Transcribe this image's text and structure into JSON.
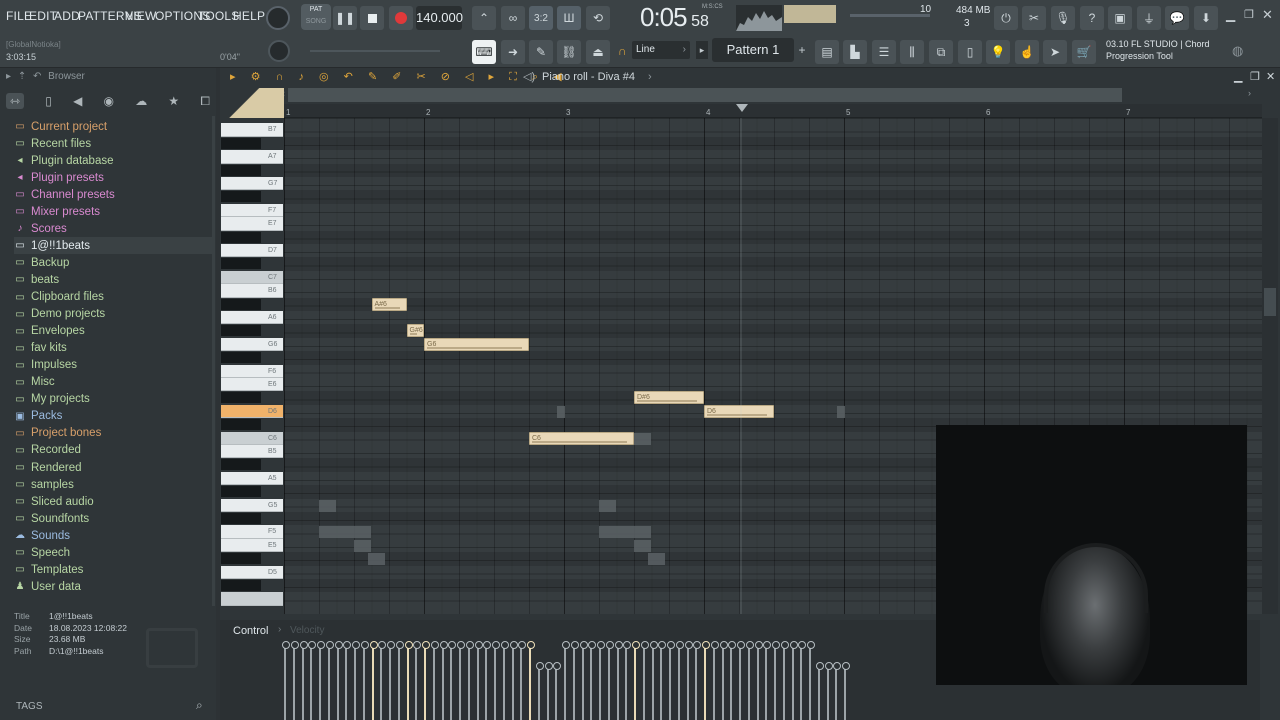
{
  "menu": [
    "FILE",
    "EDIT",
    "ADD",
    "PATTERNS",
    "VIEW",
    "OPTIONS",
    "TOOLS",
    "HELP"
  ],
  "transport": {
    "pat_label": "PAT",
    "song_label": "SONG",
    "tempo": "140.000",
    "time": "0:05",
    "time_small": "58",
    "time_unit": "M:S:CS",
    "cpu": "10",
    "mem": "484 MB",
    "voices": "3"
  },
  "hint": {
    "global": "[GlobalNotioka]",
    "time": "3:03:15",
    "position": "0'04\""
  },
  "snap": "Line",
  "pattern": "Pattern 1",
  "news": {
    "line1": "03.10  FL STUDIO | Chord",
    "line2": "Progression Tool"
  },
  "browser": {
    "title": "Browser",
    "items": [
      {
        "label": "Current project",
        "icon": "folder",
        "color": "#d8a06a"
      },
      {
        "label": "Recent files",
        "icon": "folder",
        "color": "#b7d6a4"
      },
      {
        "label": "Plugin database",
        "icon": "plug",
        "color": "#b7d6a4"
      },
      {
        "label": "Plugin presets",
        "icon": "plug",
        "color": "#d98ad0"
      },
      {
        "label": "Channel presets",
        "icon": "folder",
        "color": "#d98ad0"
      },
      {
        "label": "Mixer presets",
        "icon": "folder",
        "color": "#d98ad0"
      },
      {
        "label": "Scores",
        "icon": "note",
        "color": "#d98ad0"
      },
      {
        "label": "1@!!1beats",
        "icon": "folder",
        "color": "#e3ebef"
      },
      {
        "label": "Backup",
        "icon": "folder",
        "color": "#b7d6a4"
      },
      {
        "label": "beats",
        "icon": "folder",
        "color": "#b7d6a4"
      },
      {
        "label": "Clipboard files",
        "icon": "folder",
        "color": "#b7d6a4"
      },
      {
        "label": "Demo projects",
        "icon": "folder",
        "color": "#b7d6a4"
      },
      {
        "label": "Envelopes",
        "icon": "folder",
        "color": "#b7d6a4"
      },
      {
        "label": "fav kits",
        "icon": "folder",
        "color": "#b7d6a4"
      },
      {
        "label": "Impulses",
        "icon": "folder",
        "color": "#b7d6a4"
      },
      {
        "label": "Misc",
        "icon": "folder",
        "color": "#b7d6a4"
      },
      {
        "label": "My projects",
        "icon": "folder",
        "color": "#b7d6a4"
      },
      {
        "label": "Packs",
        "icon": "pack",
        "color": "#9bbbe0"
      },
      {
        "label": "Project bones",
        "icon": "folder",
        "color": "#d8a06a"
      },
      {
        "label": "Recorded",
        "icon": "folder",
        "color": "#b7d6a4"
      },
      {
        "label": "Rendered",
        "icon": "folder",
        "color": "#b7d6a4"
      },
      {
        "label": "samples",
        "icon": "folder",
        "color": "#b7d6a4"
      },
      {
        "label": "Sliced audio",
        "icon": "folder",
        "color": "#b7d6a4"
      },
      {
        "label": "Soundfonts",
        "icon": "folder",
        "color": "#b7d6a4"
      },
      {
        "label": "Sounds",
        "icon": "cloud",
        "color": "#9bbbe0"
      },
      {
        "label": "Speech",
        "icon": "folder",
        "color": "#b7d6a4"
      },
      {
        "label": "Templates",
        "icon": "folder",
        "color": "#b7d6a4"
      },
      {
        "label": "User data",
        "icon": "user",
        "color": "#b7d6a4"
      }
    ],
    "info": {
      "title_label": "Title",
      "title": "1@!!1beats",
      "date_label": "Date",
      "date": "18.08.2023 12:08:22",
      "size_label": "Size",
      "size": "23.68 MB",
      "path_label": "Path",
      "path": "D:\\1@!!1beats"
    },
    "tags": "TAGS"
  },
  "pianoroll": {
    "title": "Piano roll - Diva #4",
    "bars": [
      "1",
      "2",
      "3",
      "4",
      "5",
      "6",
      "7"
    ],
    "key_labels": [
      "B7",
      "A7",
      "G7",
      "F7",
      "E7",
      "D7",
      "C7",
      "B6",
      "A6",
      "G6",
      "F6",
      "E6",
      "D6",
      "C6",
      "B5",
      "A5",
      "G5",
      "F5",
      "E5",
      "D5"
    ],
    "highlighted_key": "D6",
    "notes": [
      {
        "pitch": "A#6",
        "start": 1.625,
        "length": 0.25
      },
      {
        "pitch": "G#6",
        "start": 1.875,
        "length": 0.125
      },
      {
        "pitch": "G6",
        "start": 2.0,
        "length": 0.75
      },
      {
        "pitch": "C6",
        "start": 2.75,
        "length": 0.75
      },
      {
        "pitch": "D#6",
        "start": 3.5,
        "length": 0.5
      },
      {
        "pitch": "D6",
        "start": 4.0,
        "length": 0.5
      }
    ],
    "control_label": "Control",
    "control_target": "Velocity"
  }
}
